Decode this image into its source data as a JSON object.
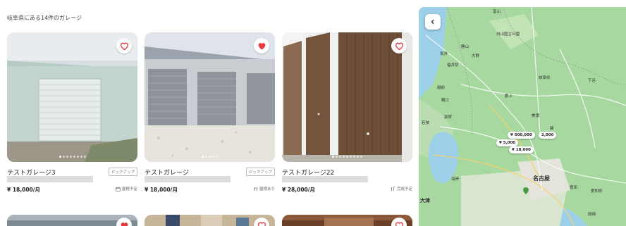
{
  "results_title": "岐阜県にある14件のガレージ",
  "cards": [
    {
      "name": "テストガレージ3",
      "tag": "ピックアップ",
      "price": "¥ 18,000/月",
      "feature": "屋根予定",
      "favorited": false
    },
    {
      "name": "テストガレージ",
      "tag": "ピックアップ",
      "price": "¥ 18,000/月",
      "feature": "屋根あり",
      "favorited": true
    },
    {
      "name": "テストガレージ22",
      "tag": "",
      "price": "¥ 28,000/月",
      "feature": "完成予定",
      "favorited": false
    }
  ],
  "map": {
    "pins": [
      "¥ 500,000",
      "2,000",
      "¥ 5,000",
      "¥ 18,000"
    ],
    "labels": [
      "岐阜県",
      "白山国立公園",
      "富山",
      "福井県",
      "大野",
      "勝山",
      "坂井",
      "越前",
      "若狭",
      "敦賀",
      "鯖江",
      "名古屋",
      "大津",
      "海岸",
      "豊田",
      "岡崎",
      "愛知県",
      "下呂",
      "美濃",
      "郡上",
      "関"
    ]
  },
  "colors": {
    "favorite": "#e8393d",
    "map_green": "#a7d8a0",
    "map_water": "#9ccfe8"
  }
}
